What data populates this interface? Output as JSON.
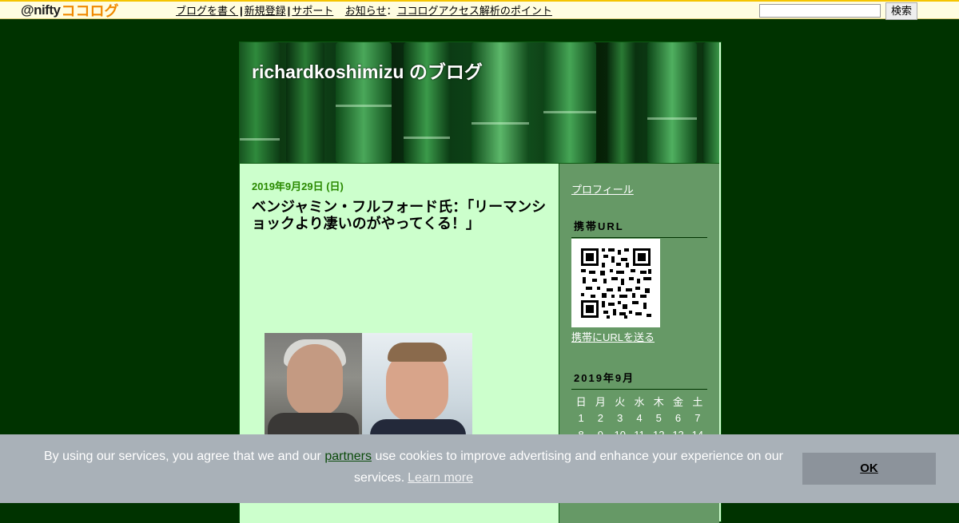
{
  "topbar": {
    "logo_prefix": "@nifty",
    "logo_suffix": "ココログ",
    "links": [
      "ブログを書く",
      "新規登録",
      "サポート",
      "お知らせ",
      "ココログアクセス解析のポイント"
    ],
    "colon": "：",
    "search_button": "検索",
    "search_value": ""
  },
  "blog": {
    "title": "richardkoshimizu のブログ"
  },
  "post": {
    "date": "2019年9月29日 (日)",
    "title": "ベンジャミン・フルフォード氏：「リーマンショックより凄いのがやってくる！」"
  },
  "sidebar": {
    "profile_link": "プロフィール",
    "mobile_heading": "携帯URL",
    "mobile_link": "携帯にURLを送る",
    "calendar_heading": "2019年9月",
    "weekdays": [
      "日",
      "月",
      "火",
      "水",
      "木",
      "金",
      "土"
    ],
    "weeks": [
      [
        "1",
        "2",
        "3",
        "4",
        "5",
        "6",
        "7"
      ],
      [
        "8",
        "9",
        "10",
        "11",
        "12",
        "13",
        "14"
      ]
    ]
  },
  "cookie": {
    "text_before": "By using our services, you agree that we and our ",
    "partners": "partners",
    "text_after": " use cookies to improve advertising and enhance your experience on our services.",
    "learn_more": "Learn more",
    "ok": "OK"
  },
  "colors": {
    "page_bg": "#003300",
    "main_bg": "#ccffcc",
    "sidebar_bg": "#669966",
    "date_color": "#2a8a00"
  }
}
